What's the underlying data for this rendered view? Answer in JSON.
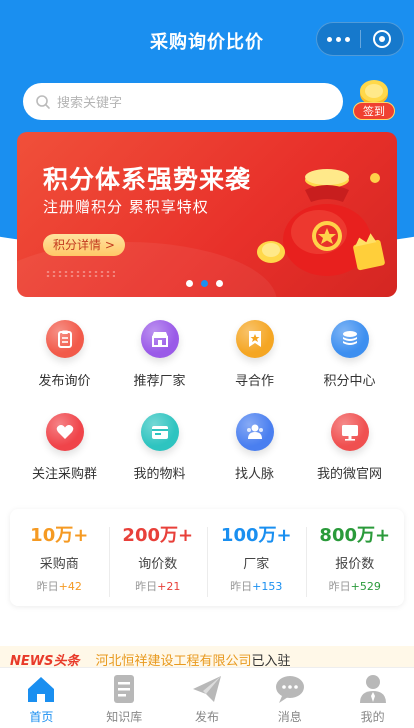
{
  "header": {
    "title": "采购询价比价"
  },
  "search": {
    "placeholder": "搜索关键字"
  },
  "signin": {
    "label": "签到"
  },
  "banner": {
    "headline": "积分体系强势来袭",
    "subline": "注册赠积分  累积享特权",
    "button_label": "积分详情 >",
    "slide_count": 3,
    "active_slide": 1
  },
  "menu": [
    {
      "label": "发布询价",
      "icon": "clipboard-icon",
      "color": "#f25a4a"
    },
    {
      "label": "推荐厂家",
      "icon": "storefront-icon",
      "color": "#9a5ae8"
    },
    {
      "label": "寻合作",
      "icon": "bookmark-star-icon",
      "color": "#f5a623"
    },
    {
      "label": "积分中心",
      "icon": "coin-stack-icon",
      "color": "#3d8ff0"
    },
    {
      "label": "关注采购群",
      "icon": "heart-icon",
      "color": "#f0444a"
    },
    {
      "label": "我的物料",
      "icon": "material-box-icon",
      "color": "#2ec4c0"
    },
    {
      "label": "找人脉",
      "icon": "people-icon",
      "color": "#4a7ff0"
    },
    {
      "label": "我的微官网",
      "icon": "monitor-icon",
      "color": "#f05050"
    }
  ],
  "stats": [
    {
      "value": "10万+",
      "name": "采购商",
      "yesterday_label": "昨日",
      "yesterday_value": "+42",
      "color": "#f59a23"
    },
    {
      "value": "200万+",
      "name": "询价数",
      "yesterday_label": "昨日",
      "yesterday_value": "+21",
      "color": "#e8403a"
    },
    {
      "value": "100万+",
      "name": "厂家",
      "yesterday_label": "昨日",
      "yesterday_value": "+153",
      "color": "#1a8ff0"
    },
    {
      "value": "800万+",
      "name": "报价数",
      "yesterday_label": "昨日",
      "yesterday_value": "+529",
      "color": "#2a9a3a"
    }
  ],
  "news": {
    "tag": "NEWS头条",
    "company": "河北恒祥建设工程有限公司",
    "suffix": "已入驻"
  },
  "tabs": [
    {
      "label": "首页",
      "icon": "home-icon",
      "active": true
    },
    {
      "label": "知识库",
      "icon": "document-icon",
      "active": false
    },
    {
      "label": "发布",
      "icon": "paper-plane-icon",
      "active": false
    },
    {
      "label": "消息",
      "icon": "chat-bubble-icon",
      "active": false
    },
    {
      "label": "我的",
      "icon": "user-icon",
      "active": false
    }
  ],
  "colors": {
    "primary": "#1a8ff0",
    "banner_red": "#e8302a",
    "tab_inactive": "#b8b8b8"
  }
}
